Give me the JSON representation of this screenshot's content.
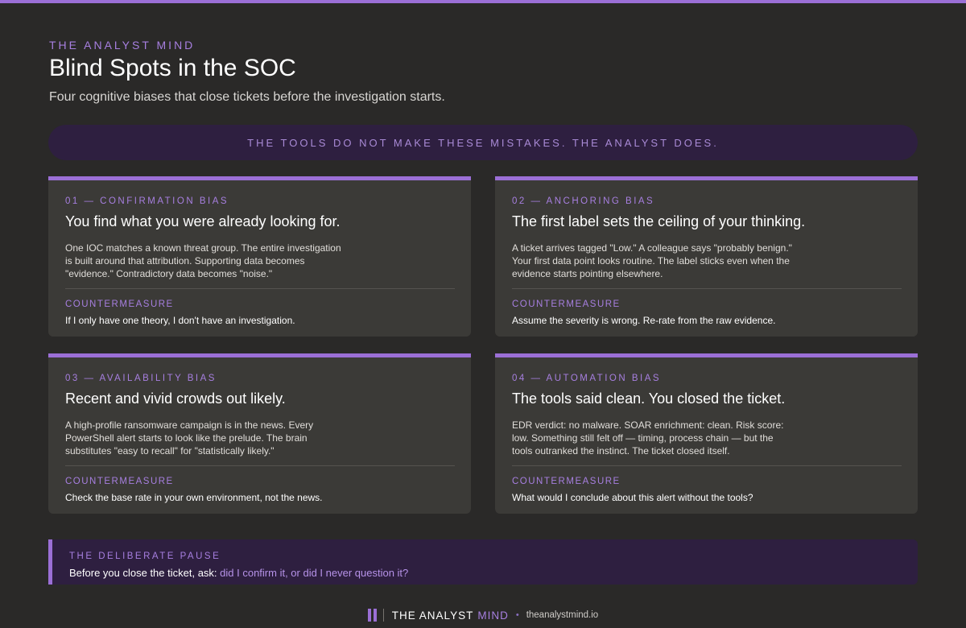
{
  "header": {
    "eyebrow": "THE ANALYST MIND",
    "title": "Blind Spots in the SOC",
    "subtitle": "Four cognitive biases that close tickets before the investigation starts."
  },
  "banner": {
    "text": "THE TOOLS DO NOT MAKE THESE MISTAKES. THE ANALYST DOES."
  },
  "cards": [
    {
      "label": "01 — CONFIRMATION BIAS",
      "headline": "You find what you were already looking for.",
      "description": "One IOC matches a known threat group. The entire investigation is built around that attribution. Supporting data becomes \"evidence.\" Contradictory data becomes \"noise.\"",
      "countermeasure_label": "COUNTERMEASURE",
      "countermeasure": "If I only have one theory, I don't have an investigation."
    },
    {
      "label": "02 — ANCHORING BIAS",
      "headline": "The first label sets the ceiling of your thinking.",
      "description": "A ticket arrives tagged \"Low.\" A colleague says \"probably benign.\" Your first data point looks routine. The label sticks even when the evidence starts pointing elsewhere.",
      "countermeasure_label": "COUNTERMEASURE",
      "countermeasure": "Assume the severity is wrong. Re-rate from the raw evidence."
    },
    {
      "label": "03 — AVAILABILITY BIAS",
      "headline": "Recent and vivid crowds out likely.",
      "description": "A high-profile ransomware campaign is in the news. Every PowerShell alert starts to look like the prelude. The brain substitutes \"easy to recall\" for \"statistically likely.\"",
      "countermeasure_label": "COUNTERMEASURE",
      "countermeasure": "Check the base rate in your own environment, not the news."
    },
    {
      "label": "04 — AUTOMATION BIAS",
      "headline": "The tools said clean. You closed the ticket.",
      "description": "EDR verdict: no malware. SOAR enrichment: clean. Risk score: low. Something still felt off — timing, process chain — but the tools outranked the instinct. The ticket closed itself.",
      "countermeasure_label": "COUNTERMEASURE",
      "countermeasure": "What would I conclude about this alert without the tools?"
    }
  ],
  "pause": {
    "label": "THE DELIBERATE PAUSE",
    "text_prefix": "Before you close the ticket, ask: ",
    "text_highlight": "did I confirm it, or did I never question it?"
  },
  "footer": {
    "brand_part1": "THE ANALYST",
    "brand_part2": "MIND",
    "separator": "•",
    "url": "theanalystmind.io"
  },
  "colors": {
    "accent": "#9b6fd6",
    "background": "#2a2928",
    "card": "#3b3a37",
    "banner": "#2e1f40"
  }
}
